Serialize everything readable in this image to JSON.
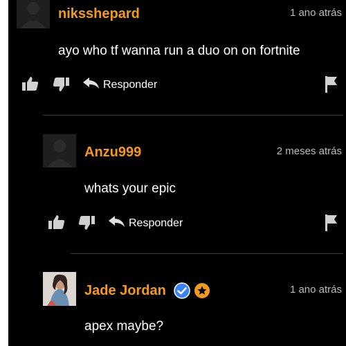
{
  "comments": [
    {
      "username": "niksshepard",
      "time": "1 ano atrás",
      "text": "ayo who tf wanna run a duo on on fortnite",
      "reply_label": "Responder"
    },
    {
      "username": "Anzu999",
      "time": "2 meses atrás",
      "text": "whats your epic",
      "reply_label": "Responder"
    },
    {
      "username": "Jade Jordan",
      "time": "1 ano atrás",
      "text": "apex maybe?",
      "badges": [
        "verified-badge",
        "star-badge"
      ]
    }
  ],
  "colors": {
    "username": "#f39a1d",
    "background": "#000000",
    "timestamp": "#bdbdbd",
    "verified": "#3b82f6",
    "star_badge": "#f39a1d"
  }
}
